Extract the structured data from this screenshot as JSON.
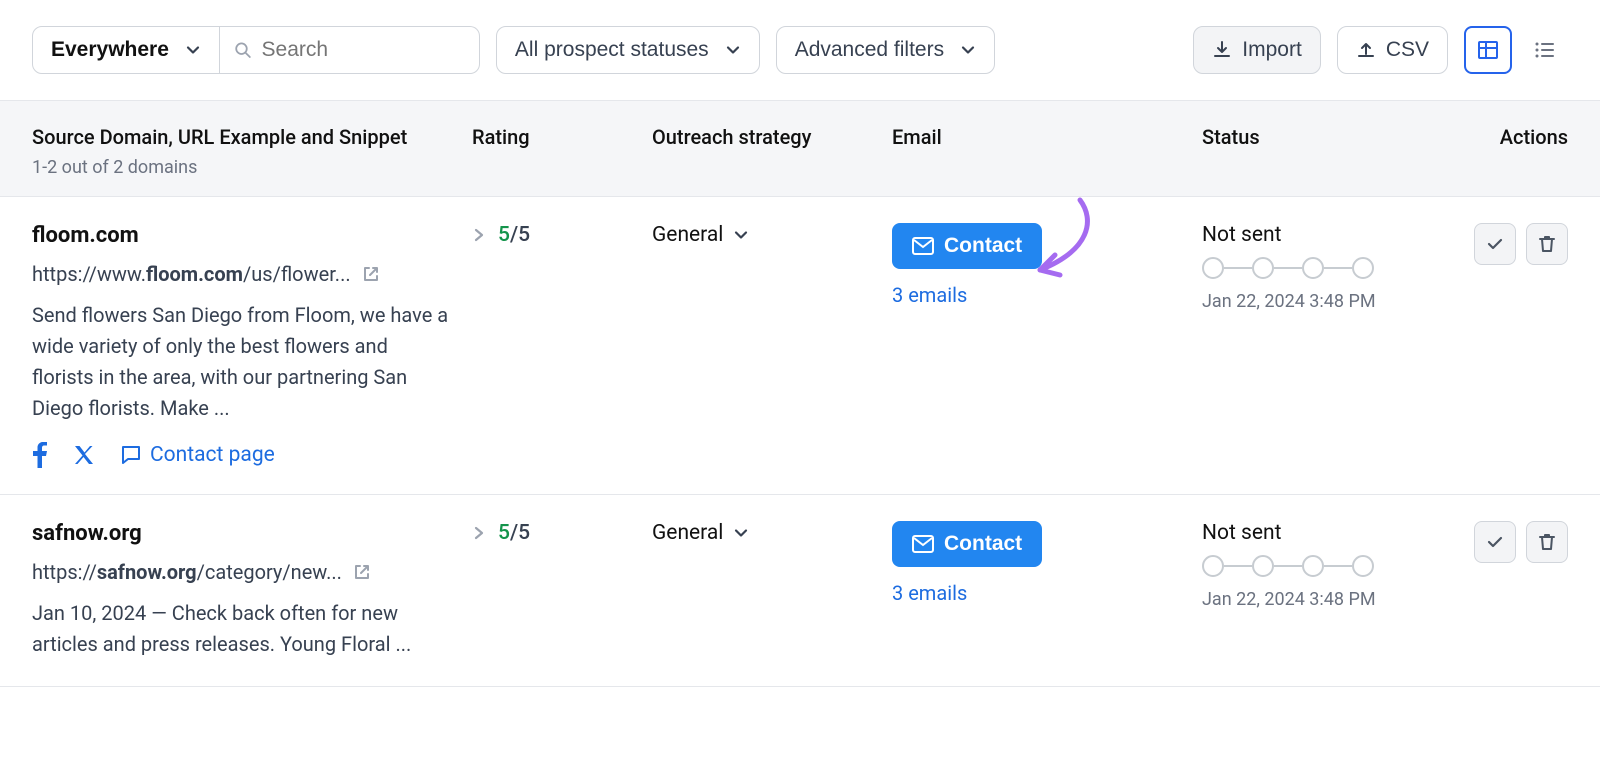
{
  "toolbar": {
    "scope": "Everywhere",
    "search_placeholder": "Search",
    "status_filter": "All prospect statuses",
    "advanced_filters": "Advanced filters",
    "import_label": "Import",
    "csv_label": "CSV"
  },
  "header": {
    "source": "Source Domain, URL Example and Snippet",
    "count": "1-2 out of 2 domains",
    "rating": "Rating",
    "strategy": "Outreach strategy",
    "email": "Email",
    "status": "Status",
    "actions": "Actions"
  },
  "rows": [
    {
      "domain": "floom.com",
      "url_prefix": "https://www.",
      "url_bold": "floom.com",
      "url_suffix": "/us/flower...",
      "snippet": "Send flowers San Diego from Floom, we have a wide variety of only the best flowers and florists in the area, with our partnering San Diego florists. Make ...",
      "show_social": true,
      "contact_page": "Contact page",
      "rating_num": "5",
      "rating_den": "/5",
      "strategy": "General",
      "contact_btn": "Contact",
      "emails": "3 emails",
      "status_label": "Not sent",
      "status_date": "Jan 22, 2024 3:48 PM"
    },
    {
      "domain": "safnow.org",
      "url_prefix": "https://",
      "url_bold": "safnow.org",
      "url_suffix": "/category/new...",
      "snippet": "Jan 10, 2024 — Check back often for new articles and press releases. Young Floral ...",
      "show_social": false,
      "rating_num": "5",
      "rating_den": "/5",
      "strategy": "General",
      "contact_btn": "Contact",
      "emails": "3 emails",
      "status_label": "Not sent",
      "status_date": "Jan 22, 2024 3:48 PM"
    }
  ]
}
